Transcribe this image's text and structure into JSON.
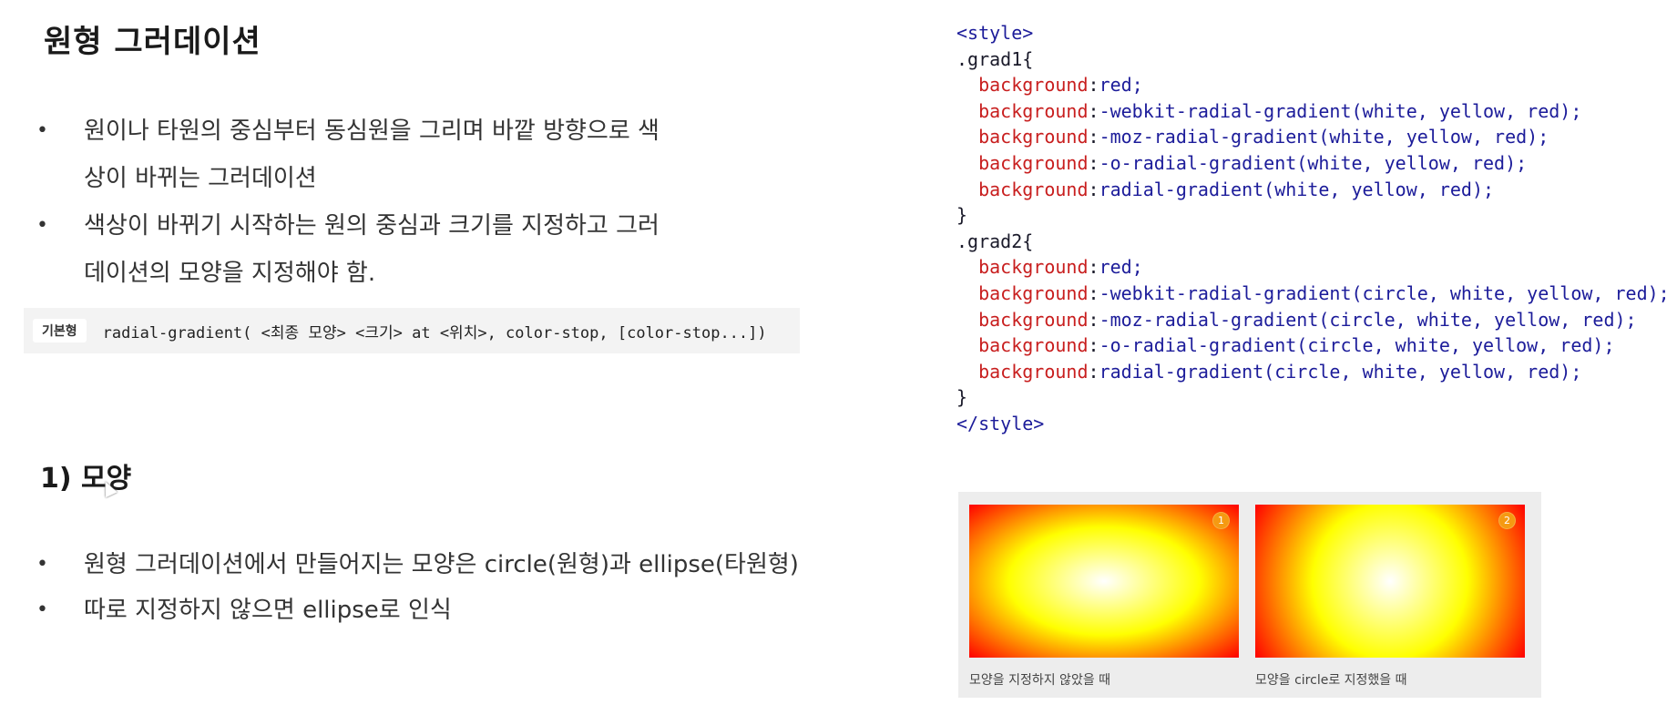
{
  "title": "원형 그러데이션",
  "intro_bullets": [
    {
      "line1": "원이나 타원의 중심부터 동심원을 그리며 바깥 방향으로 색",
      "line2": "상이 바뀌는 그러데이션"
    },
    {
      "line1": "색상이 바뀌기 시작하는 원의 중심과 크기를 지정하고 그러",
      "line2": "데이션의 모양을 지정해야 함."
    }
  ],
  "syntax": {
    "tag": "기본형",
    "formula": "radial-gradient( <최종 모양> <크기> at <위치>, color-stop, [color-stop...])"
  },
  "section": {
    "heading": "1) 모양",
    "bullets": [
      "원형 그러데이션에서 만들어지는 모양은 circle(원형)과 ellipse(타원형)",
      "따로 지정하지 않으면 ellipse로 인식"
    ]
  },
  "code": {
    "open_tag": "<style>",
    "close_tag": "</style>",
    "rules": [
      {
        "selector": ".grad1{",
        "decls": [
          {
            "prop": "background",
            "value": "red;"
          },
          {
            "prop": "background",
            "value": "-webkit-radial-gradient(white, yellow, red);"
          },
          {
            "prop": "background",
            "value": "-moz-radial-gradient(white, yellow, red);"
          },
          {
            "prop": "background",
            "value": "-o-radial-gradient(white, yellow, red);"
          },
          {
            "prop": "background",
            "value": "radial-gradient(white, yellow, red);"
          }
        ],
        "close": "}"
      },
      {
        "selector": ".grad2{",
        "decls": [
          {
            "prop": "background",
            "value": "red;"
          },
          {
            "prop": "background",
            "value": "-webkit-radial-gradient(circle, white, yellow, red);"
          },
          {
            "prop": "background",
            "value": "-moz-radial-gradient(circle, white, yellow, red);"
          },
          {
            "prop": "background",
            "value": "-o-radial-gradient(circle, white, yellow, red);"
          },
          {
            "prop": "background",
            "value": "radial-gradient(circle, white, yellow, red);"
          }
        ],
        "close": "}"
      }
    ]
  },
  "demo": {
    "items": [
      {
        "badge": "1",
        "caption": "모양을 지정하지 않았을 때"
      },
      {
        "badge": "2",
        "caption": "모양을 circle로 지정했을 때"
      }
    ]
  },
  "colors": {
    "code_tag": "#1c1c9a",
    "code_property": "#c81e1e",
    "code_value": "#1c1c9a",
    "badge": "#f59a12",
    "syntax_bg": "#f3f3f3",
    "demo_bg": "#ededed"
  }
}
